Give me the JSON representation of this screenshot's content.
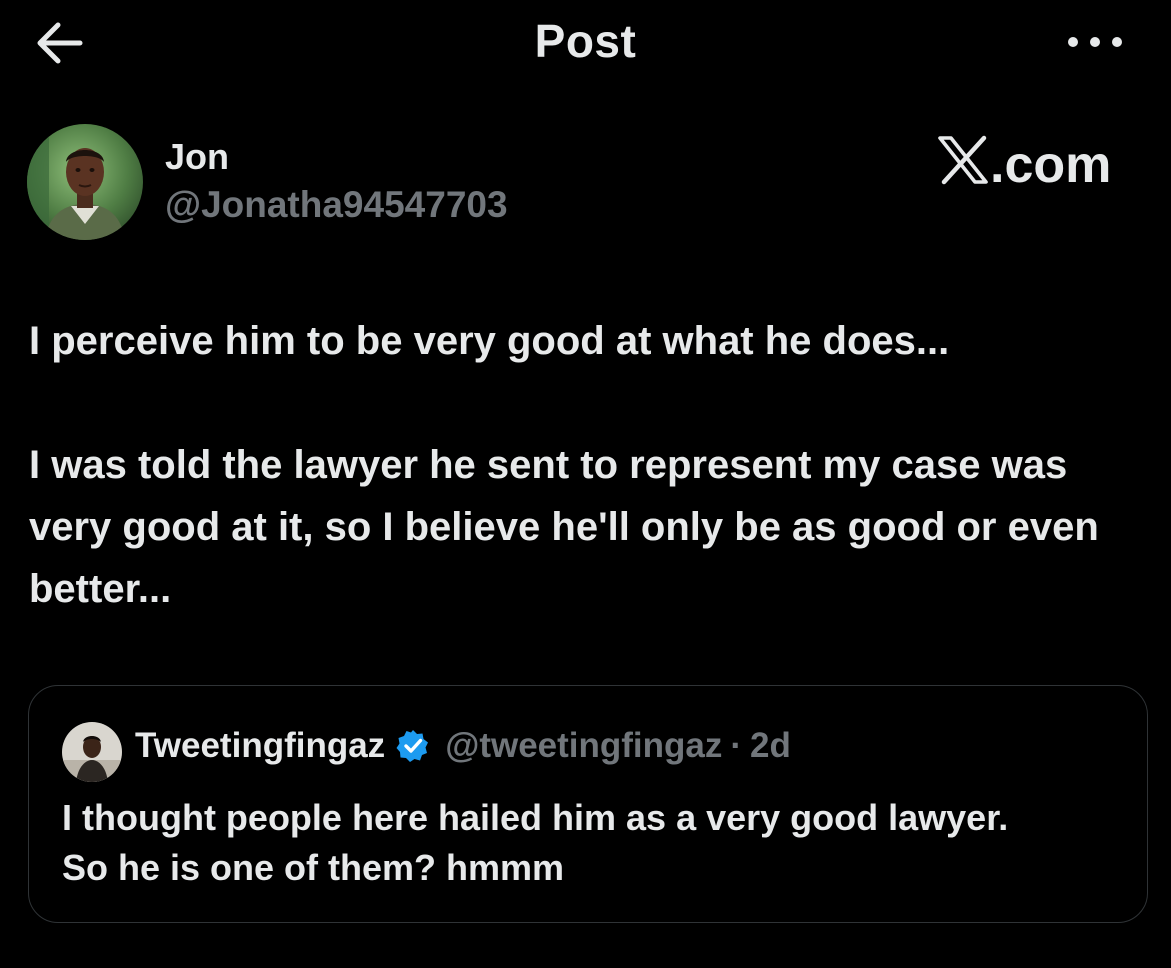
{
  "header": {
    "title": "Post",
    "back_icon": "arrow-left-icon",
    "more_icon": "more-horizontal-icon"
  },
  "author": {
    "display_name": "Jon",
    "handle": "@Jonatha94547703"
  },
  "brand": {
    "logo_text": ".com",
    "logo_letter": "X",
    "icon": "x-logo-icon"
  },
  "tweet": {
    "paragraphs": [
      "I perceive him to be very good at what he does...",
      "I was told the lawyer he sent to represent my case was very good at it, so I believe he'll only be as good or even better..."
    ]
  },
  "quote": {
    "display_name": "Tweetingfingaz",
    "verified_icon": "verified-badge-icon",
    "handle": "@tweetingfingaz",
    "separator": "·",
    "time": "2d",
    "lines": [
      "I thought people here hailed him as a very good lawyer.",
      "So he is one of them? hmmm"
    ]
  },
  "colors": {
    "background": "#000000",
    "text_primary": "#e7e9ea",
    "text_secondary": "#71767b",
    "border": "#2f3336",
    "verified_blue": "#1d9bf0"
  }
}
